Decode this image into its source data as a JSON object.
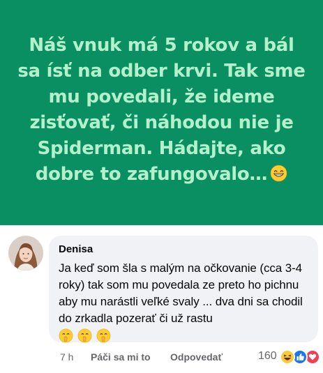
{
  "post": {
    "text": "Náš vnuk má 5 rokov a bál sa ísť na odber krvi. Tak sme mu povedali, že ideme zisťovať, či náhodou nie je Spiderman. Hádajte, ako dobre to zafungovalo…",
    "emoji_icon": "grinning-face-emoji",
    "background_color": "#0a8f63",
    "text_color": "#b5f0cc"
  },
  "comment": {
    "author": "Denisa",
    "text": "Ja keď som šla s malým na očkovanie (cca 3-4 roky) tak som mu povedala ze preto ho pichnu aby mu narástli veľké svaly ... dva dni sa chodil do zrkadla pozerať či už rastu",
    "emojis": [
      "shushing-face-emoji",
      "shushing-face-emoji",
      "shushing-face-emoji"
    ],
    "bubble_color": "#f0f2f5"
  },
  "actions": {
    "time": "7 h",
    "like_label": "Páči sa mi to",
    "reply_label": "Odpovedať",
    "reaction_count": "160",
    "reaction_icons": [
      "haha-icon",
      "like-icon",
      "love-icon"
    ]
  }
}
